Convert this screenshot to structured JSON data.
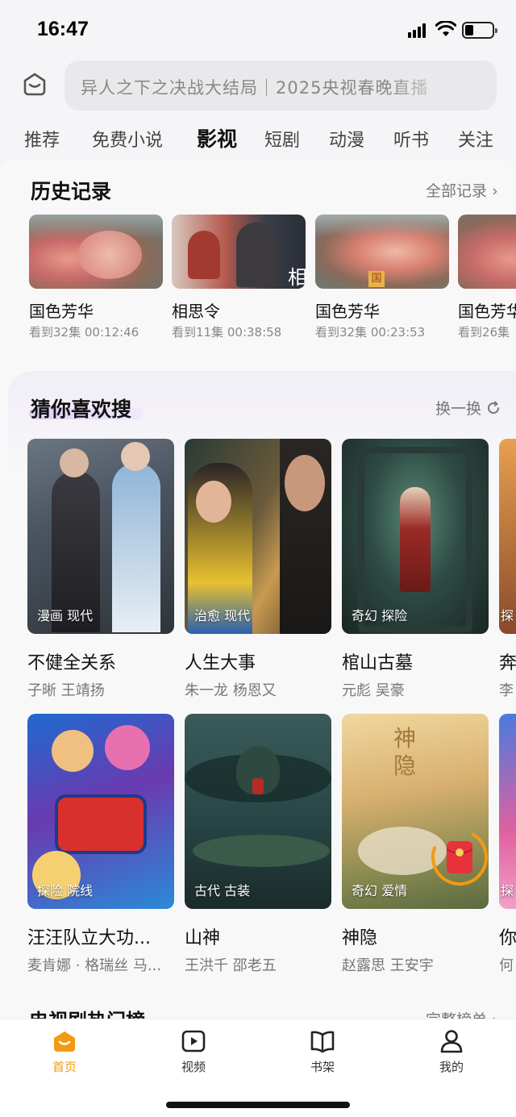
{
  "status_bar": {
    "time": "16:47"
  },
  "search": {
    "text": "异人之下之决战大结局｜2025央视春晚直播"
  },
  "tabs": [
    {
      "label": "推荐"
    },
    {
      "label": "免费小说"
    },
    {
      "label": "影视",
      "active": true
    },
    {
      "label": "短剧"
    },
    {
      "label": "动漫"
    },
    {
      "label": "听书"
    },
    {
      "label": "关注"
    }
  ],
  "history": {
    "title": "历史记录",
    "link": "全部记录",
    "items": [
      {
        "title": "国色芳华",
        "progress": "看到32集 00:12:46"
      },
      {
        "title": "相思令",
        "progress": "看到11集 00:38:58",
        "poster_text": "相"
      },
      {
        "title": "国色芳华",
        "progress": "看到32集 00:23:53",
        "poster_text": "国"
      },
      {
        "title": "国色芳华",
        "progress": "看到26集"
      }
    ]
  },
  "guess": {
    "title": "猜你喜欢搜",
    "link": "换一换",
    "row1": [
      {
        "title": "不健全关系",
        "cast": "子晰 王靖扬",
        "tags": "漫画 现代"
      },
      {
        "title": "人生大事",
        "cast": "朱一龙 杨恩又",
        "tags": "治愈 现代"
      },
      {
        "title": "棺山古墓",
        "cast": "元彪 吴豪",
        "tags": "奇幻 探险"
      },
      {
        "title": "奔",
        "cast": "李",
        "tags": "探"
      }
    ],
    "row2": [
      {
        "title": "汪汪队立大功...",
        "cast": "麦肯娜 · 格瑞丝 马...",
        "tags": "探险 院线"
      },
      {
        "title": "山神",
        "cast": "王洪千 邵老五",
        "tags": "古代 古装"
      },
      {
        "title": "神隐",
        "cast": "赵露思 王安宇",
        "tags": "奇幻 爱情",
        "poster_text": "神隐"
      },
      {
        "title": "你",
        "cast": "何",
        "tags": "探"
      }
    ]
  },
  "next_section": {
    "title": "电视剧热门榜",
    "link": "完整榜单"
  },
  "bottom_nav": [
    {
      "label": "首页",
      "active": true,
      "icon": "home-icon"
    },
    {
      "label": "视频",
      "icon": "video-icon"
    },
    {
      "label": "书架",
      "icon": "book-icon"
    },
    {
      "label": "我的",
      "icon": "profile-icon"
    }
  ],
  "colors": {
    "accent": "#f29a12",
    "red_packet": "#e8323c"
  }
}
